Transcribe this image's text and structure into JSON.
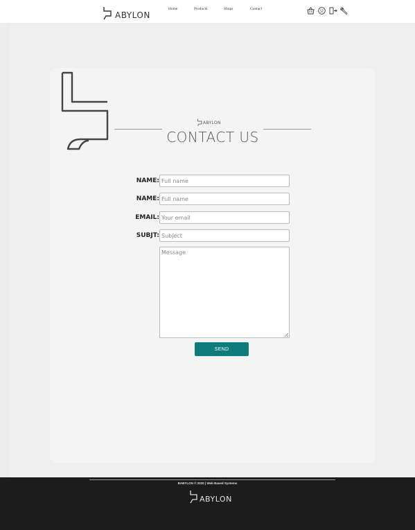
{
  "header": {
    "brand": "ABYLON",
    "nav": [
      {
        "label": "Home"
      },
      {
        "label": "Products"
      },
      {
        "label": "Shops"
      },
      {
        "label": "Contact"
      }
    ],
    "icons": [
      "basket-icon",
      "user-icon",
      "logout-icon",
      "wrench-icon"
    ]
  },
  "contact": {
    "logo_text": "ABYLON",
    "title": "CONTACT US",
    "fields": [
      {
        "label": "NAME:",
        "placeholder": "Full name"
      },
      {
        "label": "NAME:",
        "placeholder": "Full name"
      },
      {
        "label": "EMAIL:",
        "placeholder": "Your email"
      },
      {
        "label": "SUBJT:",
        "placeholder": "Subject"
      }
    ],
    "message_placeholder": "Message",
    "send_label": "SEND"
  },
  "footer": {
    "copyright": "BABYLON © 2020 | Web Based Systems",
    "logo_text": "ABYLON"
  },
  "colors": {
    "accent": "#0f7b7b",
    "footer_bg": "#1c1c1c"
  }
}
